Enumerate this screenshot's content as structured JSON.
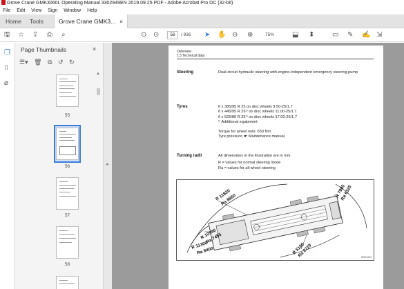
{
  "window": {
    "title": "Grove Crane GMK3060L Operating Manual 3302949EN 2019.09.25.PDF - Adobe Acrobat Pro DC (32-bit)"
  },
  "menu": {
    "items": [
      "File",
      "Edit",
      "View",
      "Sign",
      "Window",
      "Help"
    ]
  },
  "tabs": {
    "home": "Home",
    "tools": "Tools",
    "document": "Grove Crane GMK3...",
    "close": "×"
  },
  "toolbar": {
    "page_current": "56",
    "page_total": "/ 936",
    "zoom": "75%"
  },
  "thumbnail_panel": {
    "title": "Page Thumbnails",
    "close": "×",
    "pages": [
      {
        "label": "55",
        "selected": false
      },
      {
        "label": "56",
        "selected": true
      },
      {
        "label": "57",
        "selected": false
      },
      {
        "label": "58",
        "selected": false
      }
    ]
  },
  "document": {
    "header_line1": "Overview",
    "header_line2": "1.5 Technical data",
    "steering": {
      "label": "Steering",
      "text": "Dual-circuit hydraulic steering with engine-independent emergency steering pump"
    },
    "tyres": {
      "label": "Tyres",
      "line1": "6 x 385/95 R 25 on disc wheels 9.50-25/1.7",
      "line2": "6 x 445/95 R 25¹⁾ on disc wheels 11.00-25/1.7",
      "line3": "6 x 525/80 R 25¹⁾ on disc wheels 17.00-25/1.7",
      "footnote": "¹⁾ Additional equipment",
      "torque": "Torque for wheel nuts: 650 Nm.",
      "pressure": "Tyre pressure; ☛ Maintenance manual."
    },
    "turning_radii": {
      "label": "Turning radii",
      "intro": "All dimensions in the illustration are in mm.",
      "r_line": "R    = values for normal steering mode",
      "ra_line": "Ra  = values for all-wheel steering"
    },
    "drawing": {
      "labels": {
        "r11820": "R 11820",
        "ra8860": "Ra 8860",
        "r7985": "R 7985",
        "ra6325": "Ra 6325",
        "r10590": "R 10590",
        "ra7485": "Ra 7485",
        "r11300": "R 11300",
        "ra8400": "Ra 8400",
        "r5100": "R 5100",
        "ra2720": "Ra 2720"
      },
      "code": "MS03493"
    }
  }
}
